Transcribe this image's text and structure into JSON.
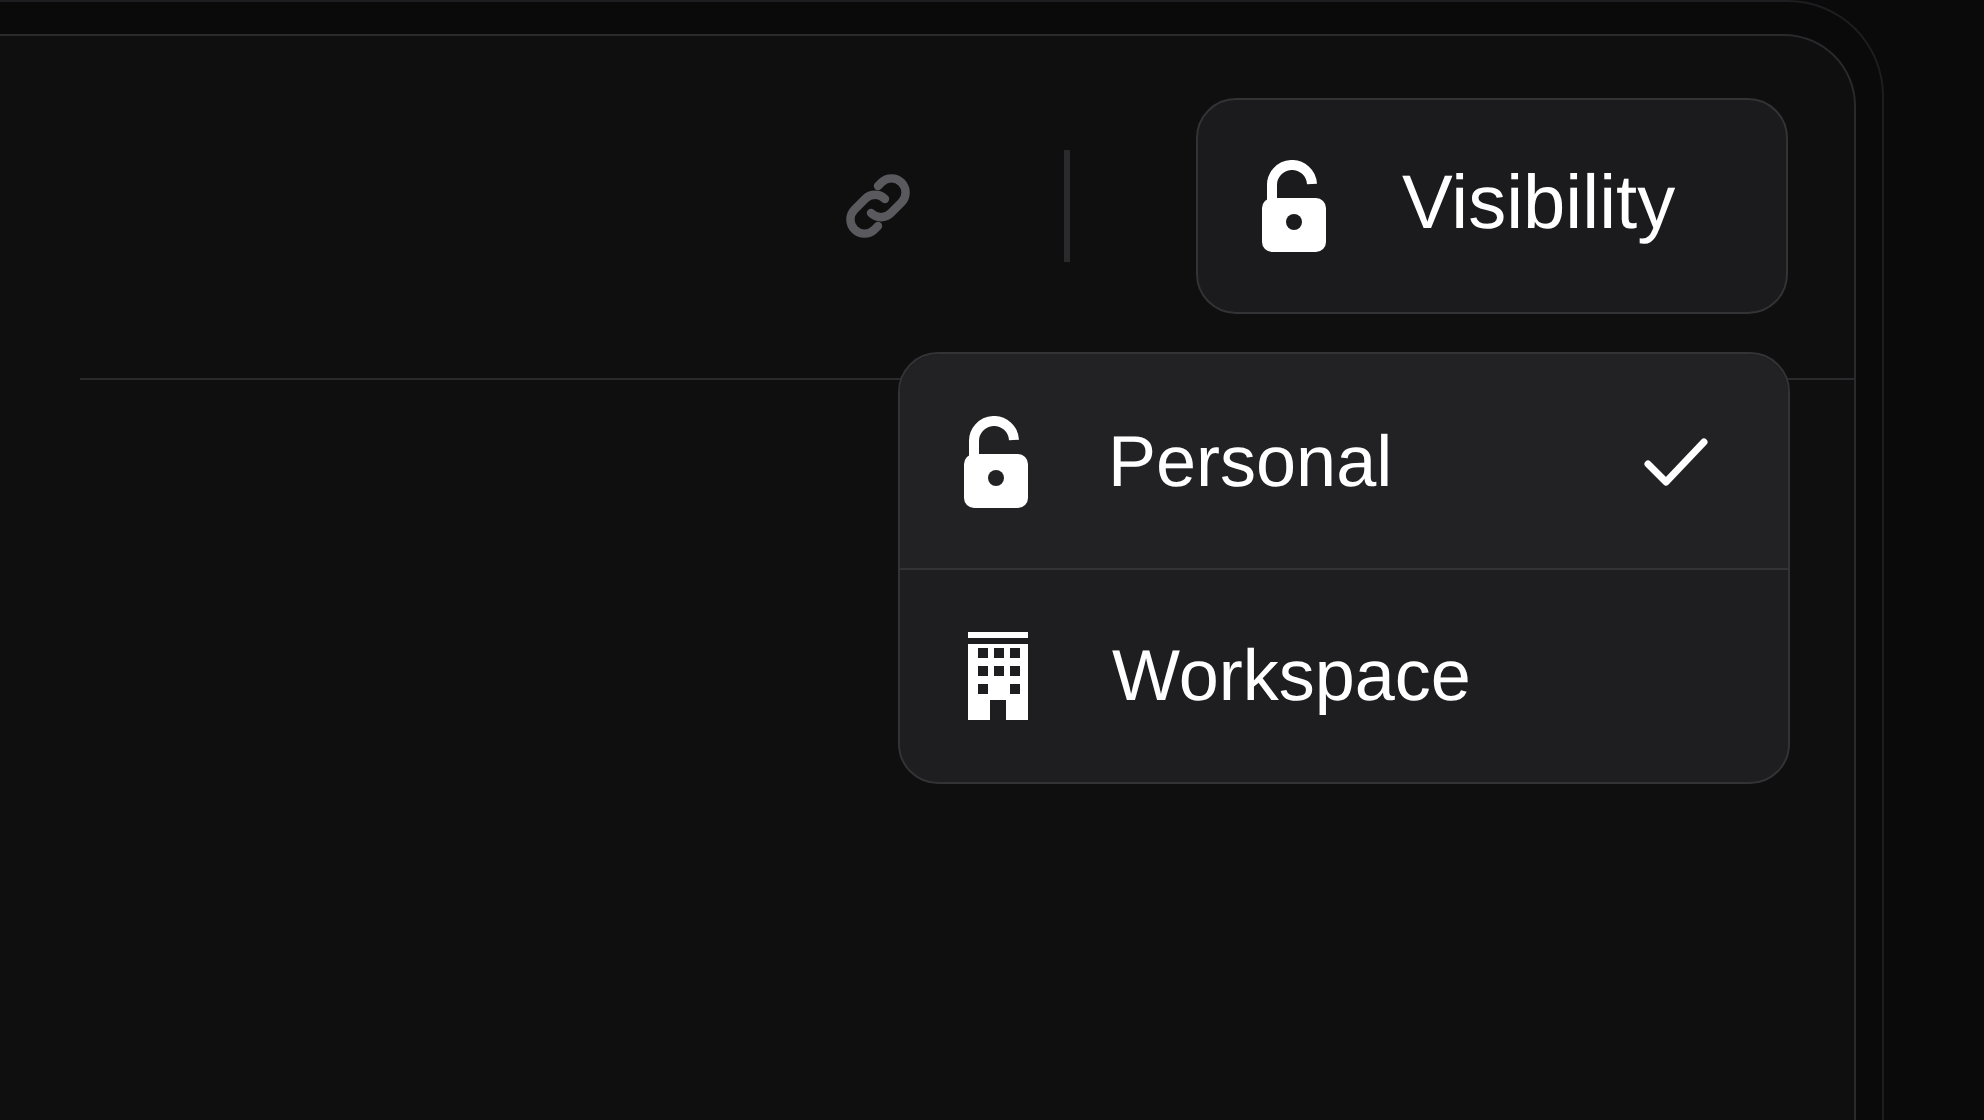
{
  "toolbar": {
    "visibility_button": {
      "label": "Visibility"
    }
  },
  "visibility_menu": {
    "items": [
      {
        "label": "Personal",
        "kind": "lock",
        "selected": true
      },
      {
        "label": "Workspace",
        "kind": "building",
        "selected": false
      }
    ]
  }
}
